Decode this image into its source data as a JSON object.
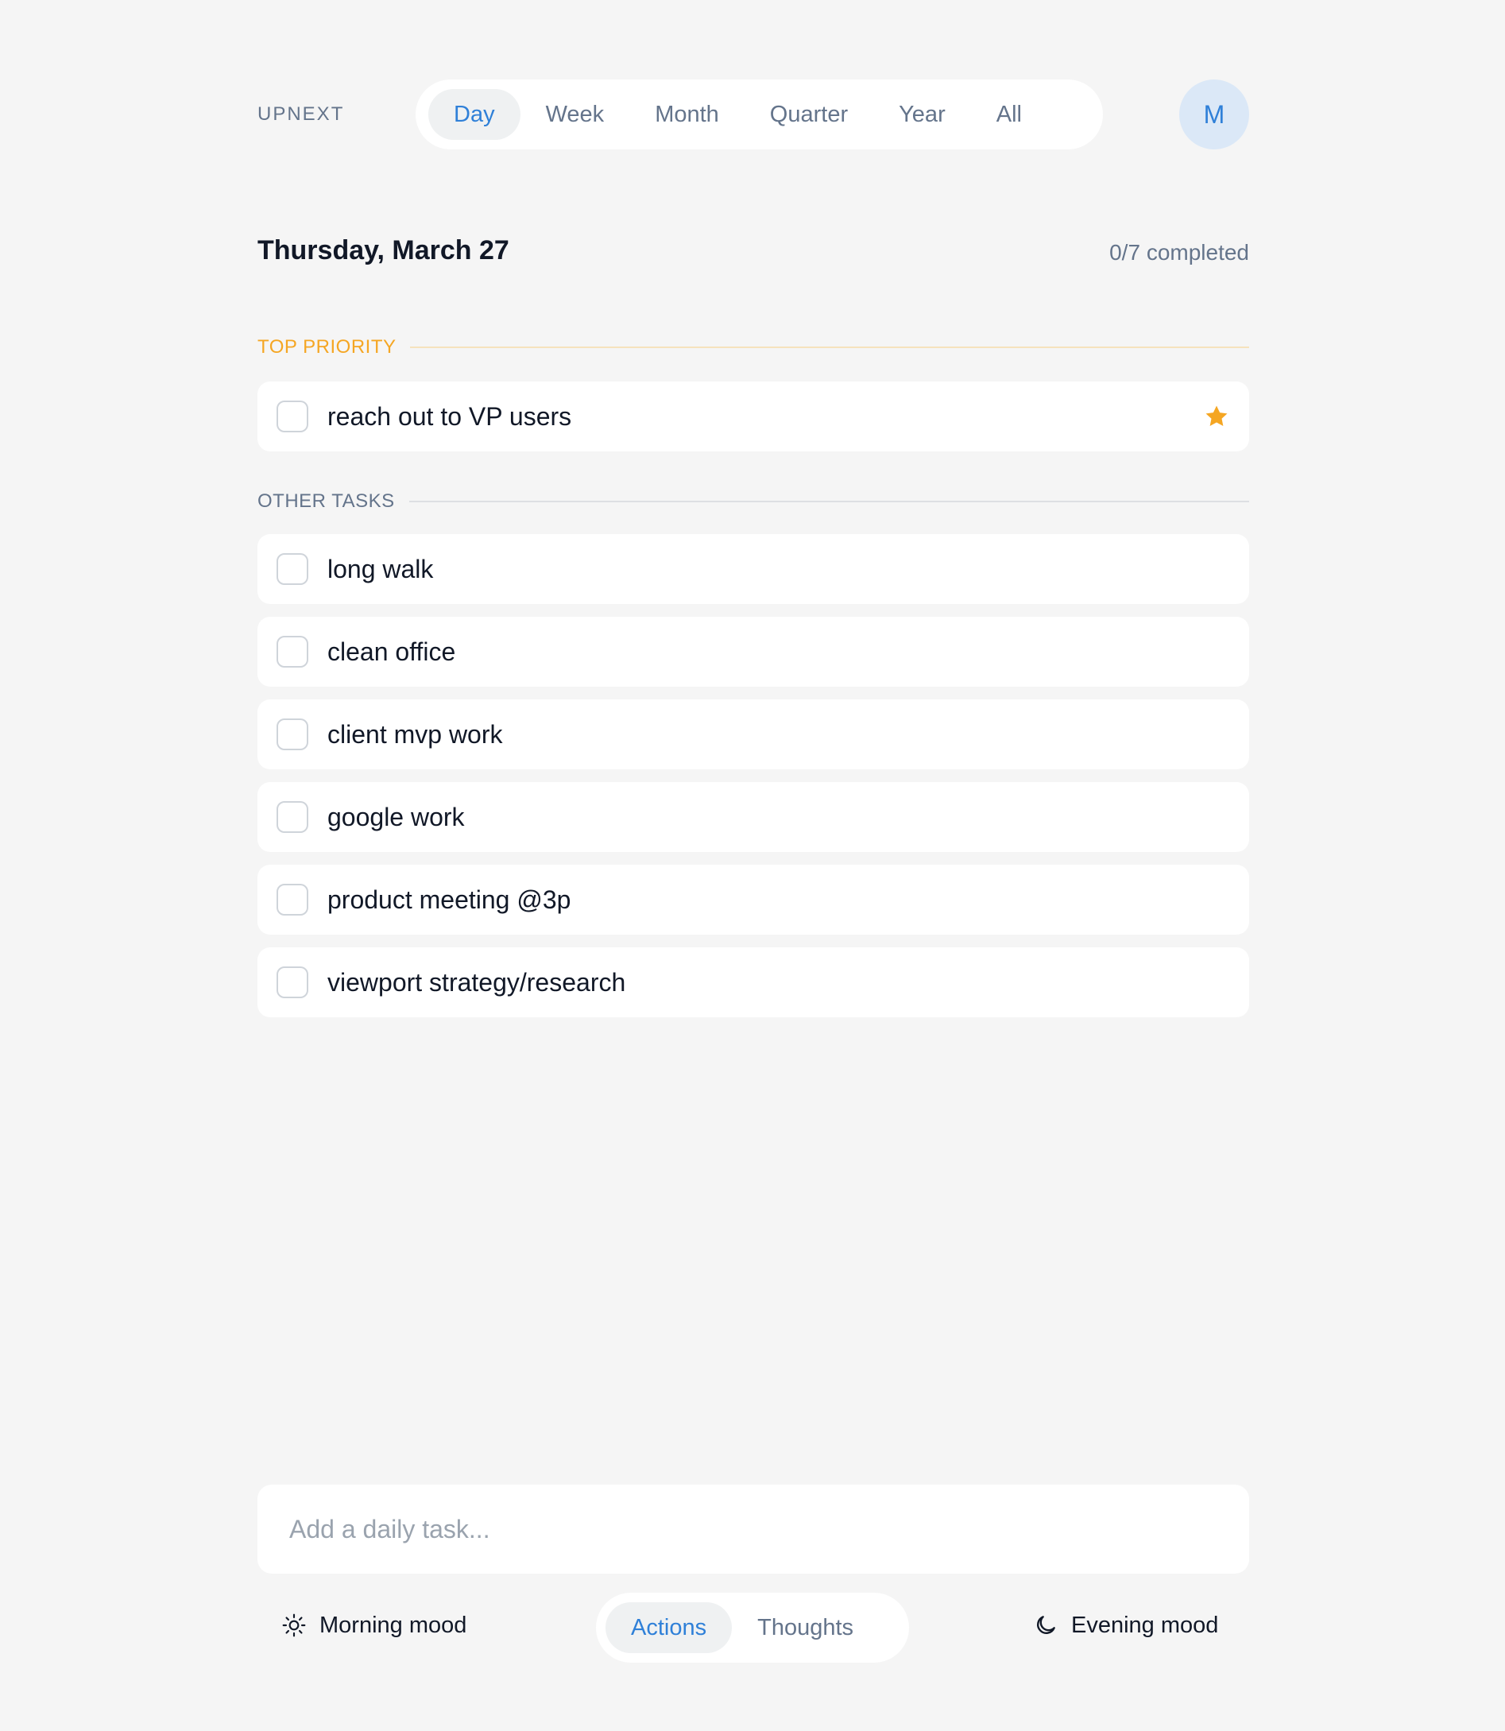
{
  "header": {
    "brand": "UPNEXT",
    "period_tabs": [
      {
        "label": "Day",
        "active": true
      },
      {
        "label": "Week",
        "active": false
      },
      {
        "label": "Month",
        "active": false
      },
      {
        "label": "Quarter",
        "active": false
      },
      {
        "label": "Year",
        "active": false
      },
      {
        "label": "All",
        "active": false
      }
    ],
    "avatar_initial": "M"
  },
  "summary": {
    "date": "Thursday, March 27",
    "completed": "0/7 completed"
  },
  "top_priority": {
    "heading": "TOP PRIORITY",
    "tasks": [
      {
        "label": "reach out to VP users",
        "done": false,
        "starred": true
      }
    ]
  },
  "other_tasks": {
    "heading": "OTHER TASKS",
    "tasks": [
      {
        "label": "long walk",
        "done": false
      },
      {
        "label": "clean office",
        "done": false
      },
      {
        "label": "client mvp work",
        "done": false
      },
      {
        "label": "google work",
        "done": false
      },
      {
        "label": "product meeting @3p",
        "done": false
      },
      {
        "label": "viewport strategy/research",
        "done": false
      }
    ]
  },
  "add_task": {
    "placeholder": "Add a daily task...",
    "value": ""
  },
  "footer": {
    "morning_mood": {
      "label": "Morning mood",
      "icon": "sun-icon"
    },
    "evening_mood": {
      "label": "Evening mood",
      "icon": "moon-icon"
    },
    "mode_tabs": [
      {
        "label": "Actions",
        "active": true
      },
      {
        "label": "Thoughts",
        "active": false
      }
    ]
  },
  "colors": {
    "accent": "#2f80d8",
    "priority": "#f5a623",
    "background": "#f5f5f5",
    "muted": "#64748b"
  }
}
